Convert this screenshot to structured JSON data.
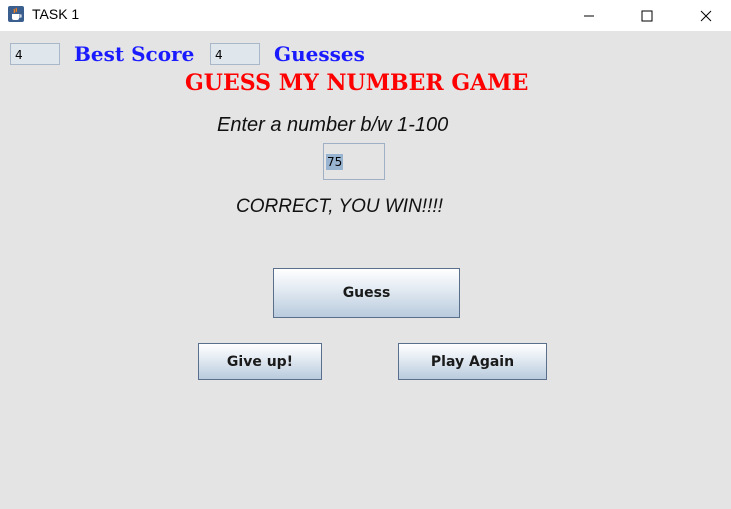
{
  "window": {
    "title": "TASK 1",
    "icon": "java-cup-icon"
  },
  "scoreboard": {
    "best_score_value": "4",
    "best_score_label": "Best Score",
    "guesses_value": "4",
    "guesses_label": "Guesses"
  },
  "game": {
    "title": "GUESS MY NUMBER GAME",
    "prompt": "Enter a number b/w 1-100",
    "input_value": "75",
    "result": "CORRECT, YOU WIN!!!!"
  },
  "buttons": {
    "guess": "Guess",
    "give_up": "Give up!",
    "play_again": "Play Again"
  },
  "colors": {
    "title_red": "#ff0000",
    "label_blue": "#1a1aff",
    "background": "#e4e4e4"
  }
}
